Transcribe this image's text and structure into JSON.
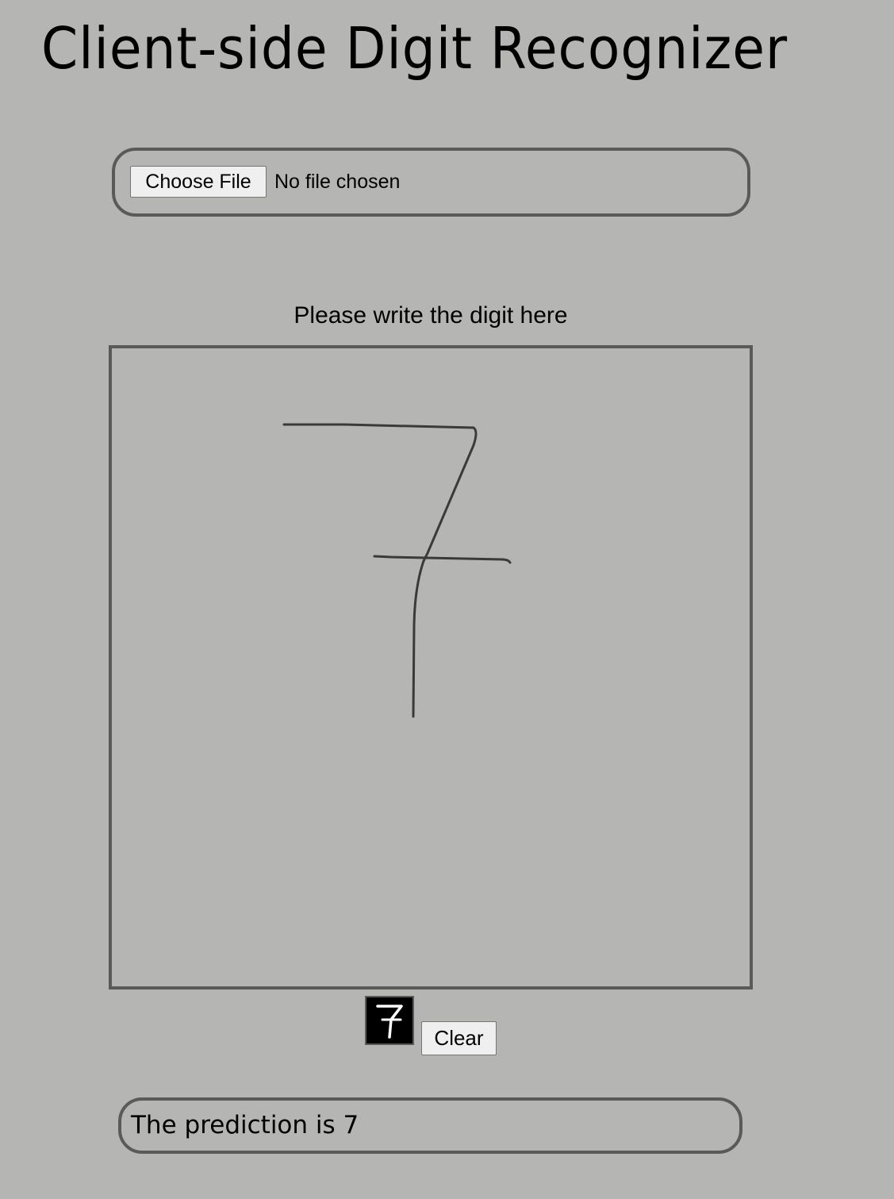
{
  "header": {
    "title": "Client-side Digit Recognizer"
  },
  "file_input": {
    "button_label": "Choose File",
    "status": "No file chosen"
  },
  "canvas": {
    "label": "Please write the digit here",
    "drawn_digit": "7"
  },
  "preview": {
    "digit": "7"
  },
  "controls": {
    "clear_label": "Clear"
  },
  "result": {
    "text": "The prediction is 7"
  },
  "colors": {
    "background": "#b5b5b3",
    "border": "#5a5a5a",
    "stroke": "#3a3a3a",
    "thumbnail_background": "#000000",
    "thumbnail_stroke": "#ffffff"
  }
}
